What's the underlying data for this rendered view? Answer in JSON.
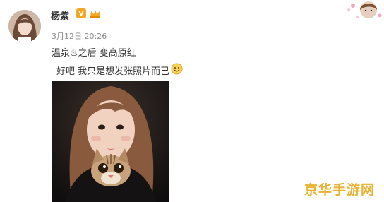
{
  "post": {
    "username": "杨紫",
    "verified_badge": "V",
    "timestamp": "3月12日 20:26",
    "text_line1": "温泉♨之后 变高原红",
    "text_line2": "好吧 我只是想发张照片而已"
  },
  "icons": {
    "verified": "verified-v-icon",
    "member": "crown-member-icon",
    "smile": "smile-emoji-icon"
  },
  "watermark": {
    "text": "京华手游网"
  },
  "colors": {
    "badge": "#f5a623",
    "watermark": "#e8b233",
    "timestamp": "#8a8a8a",
    "text": "#333333"
  }
}
